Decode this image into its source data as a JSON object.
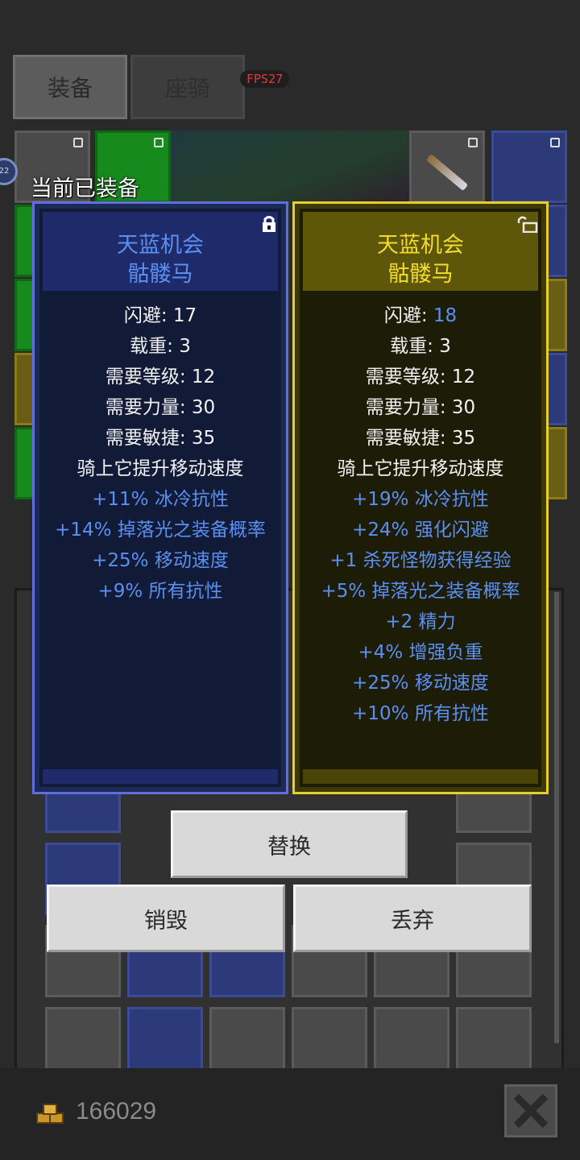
{
  "tabs": {
    "equipment": "装备",
    "mount": "座骑"
  },
  "fps": "FPS27",
  "level_badge": "22",
  "equipped_label": "当前已装备",
  "card_left": {
    "title": "天蓝机会",
    "subtitle": "骷髅马",
    "stats": [
      {
        "label": "闪避: ",
        "value": "17"
      },
      {
        "label": "载重: ",
        "value": "3"
      },
      {
        "label": "需要等级: ",
        "value": "12"
      },
      {
        "label": "需要力量: ",
        "value": "30"
      },
      {
        "label": "需要敏捷: ",
        "value": "35"
      }
    ],
    "effect": "骑上它提升移动速度",
    "affixes": [
      "+11% 冰冷抗性",
      "+14% 掉落光之装备概率",
      "+25% 移动速度",
      "+9% 所有抗性"
    ],
    "locked": true
  },
  "card_right": {
    "title": "天蓝机会",
    "subtitle": "骷髅马",
    "stats": [
      {
        "label": "闪避: ",
        "value": "18",
        "improved": true
      },
      {
        "label": "载重: ",
        "value": "3"
      },
      {
        "label": "需要等级: ",
        "value": "12"
      },
      {
        "label": "需要力量: ",
        "value": "30"
      },
      {
        "label": "需要敏捷: ",
        "value": "35"
      }
    ],
    "effect": "骑上它提升移动速度",
    "affixes": [
      "+19% 冰冷抗性",
      "+24% 强化闪避",
      "+1 杀死怪物获得经验",
      "+5% 掉落光之装备概率",
      "+2 精力",
      "+4% 增强负重",
      "+25% 移动速度",
      "+10% 所有抗性"
    ],
    "locked": false
  },
  "buttons": {
    "replace": "替换",
    "destroy": "销毁",
    "discard": "丢弃"
  },
  "gold": "166029",
  "colors": {
    "affix_blue": "#5b8ff0",
    "title_yellow": "#f3dc2e",
    "left_border": "#6070d8",
    "right_border": "#e6cf2a"
  }
}
